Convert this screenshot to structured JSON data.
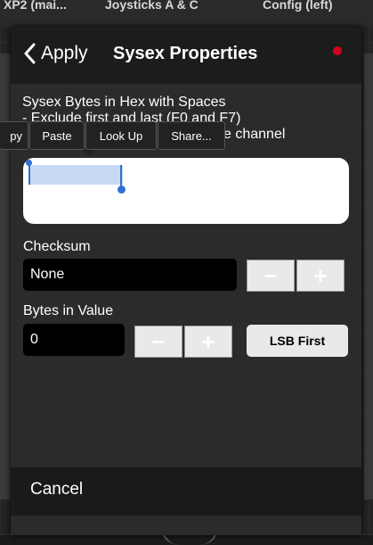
{
  "background": {
    "tabs": [
      "XP2 (mai...",
      "Joysticks A & C",
      "Config (left)"
    ],
    "bottom_label": "midi channel"
  },
  "navbar": {
    "back_label": "Apply",
    "title": "Sysex Properties",
    "record_color": "#d0021b"
  },
  "description": {
    "line1": "Sysex Bytes in Hex with Spaces",
    "line2": "- Exclude first and last (F0 and F7)",
    "line3_visible": "e channel"
  },
  "edit_menu": {
    "items": [
      "py",
      "Paste",
      "Look Up",
      "Share..."
    ]
  },
  "sysex_input": {
    "value": ""
  },
  "checksum": {
    "label": "Checksum",
    "value": "None",
    "minus": "−",
    "plus": "+"
  },
  "bytes_in_value": {
    "label": "Bytes in Value",
    "value": "0",
    "minus": "−",
    "plus": "+",
    "order_button": "LSB First"
  },
  "footer": {
    "cancel_label": "Cancel"
  }
}
